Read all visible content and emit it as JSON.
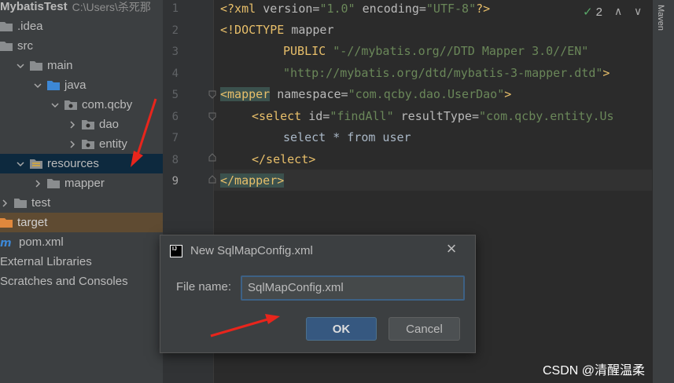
{
  "project": {
    "root_name": "MybatisTest",
    "root_path": "C:\\Users\\杀死那",
    "items": [
      {
        "label": ".idea",
        "indent": 0,
        "chevron": "none",
        "folder": "plain"
      },
      {
        "label": "src",
        "indent": 0,
        "chevron": "none",
        "folder": "plain"
      },
      {
        "label": "main",
        "indent": 1,
        "chevron": "down",
        "folder": "plain"
      },
      {
        "label": "java",
        "indent": 2,
        "chevron": "down",
        "folder": "source"
      },
      {
        "label": "com.qcby",
        "indent": 3,
        "chevron": "down",
        "folder": "package"
      },
      {
        "label": "dao",
        "indent": 4,
        "chevron": "right",
        "folder": "package"
      },
      {
        "label": "entity",
        "indent": 4,
        "chevron": "right",
        "folder": "package"
      },
      {
        "label": "resources",
        "indent": 1,
        "chevron": "down",
        "folder": "resources"
      },
      {
        "label": "mapper",
        "indent": 2,
        "chevron": "right",
        "folder": "plain"
      },
      {
        "label": "test",
        "indent": 0,
        "chevron": "right",
        "folder": "plain"
      },
      {
        "label": "target",
        "indent": 0,
        "chevron": "none",
        "folder": "excluded"
      },
      {
        "label": "pom.xml",
        "indent": 0,
        "chevron": "none",
        "folder": "maven"
      },
      {
        "label": "External Libraries",
        "indent": 0,
        "chevron": "none",
        "folder": "none"
      },
      {
        "label": "Scratches and Consoles",
        "indent": 0,
        "chevron": "none",
        "folder": "none"
      }
    ]
  },
  "editor": {
    "line_numbers": [
      "1",
      "2",
      "3",
      "4",
      "5",
      "6",
      "7",
      "8",
      "9"
    ],
    "lines": {
      "l1": {
        "a": "<?xml ",
        "b": "version=",
        "c": "\"1.0\"",
        "d": " encoding=",
        "e": "\"UTF-8\"",
        "f": "?>"
      },
      "l2": {
        "a": "<!DOCTYPE ",
        "b": "mapper"
      },
      "l3": {
        "a": "PUBLIC ",
        "b": "\"-//mybatis.org//DTD Mapper 3.0//EN\""
      },
      "l4": {
        "a": "\"http://mybatis.org/dtd/mybatis-3-mapper.dtd\"",
        "b": ">"
      },
      "l5": {
        "a": "<mapper",
        "b": " namespace=",
        "c": "\"com.qcby.dao.UserDao\"",
        "d": ">"
      },
      "l6": {
        "a": "<select",
        "b": " id=",
        "c": "\"findAll\"",
        "d": " resultType=",
        "e": "\"com.qcby.entity.Us"
      },
      "l7": {
        "a": "select * from user"
      },
      "l8": {
        "a": "</select>"
      },
      "l9": {
        "a": "</mapper>"
      }
    },
    "inspection_count": "2",
    "check_icon": "check-icon"
  },
  "side_tool": {
    "label": "Maven"
  },
  "dialog": {
    "title": "New SqlMapConfig.xml",
    "field_label": "File name:",
    "field_value": "SqlMapConfig.xml",
    "ok_label": "OK",
    "cancel_label": "Cancel"
  },
  "watermark": "CSDN @清醒温柔",
  "colors": {
    "accent": "#365880",
    "annotation_arrow": "#e8251c"
  }
}
